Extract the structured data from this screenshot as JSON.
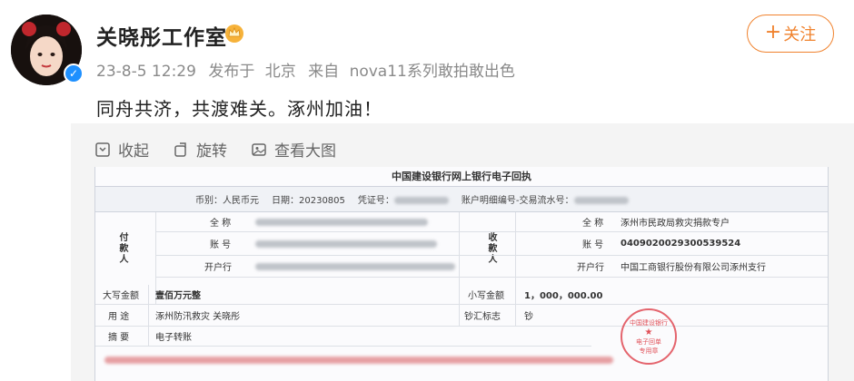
{
  "user": {
    "name": "关晓彤工作室",
    "verified_mark": "✓"
  },
  "meta": {
    "date_time": "23-8-5 12:29",
    "published_prefix": "发布于",
    "location": "北京",
    "source_prefix": "来自",
    "device": "nova11系列敢拍敢出色"
  },
  "follow": {
    "plus": "+",
    "label": "关注"
  },
  "post": {
    "text": "同舟共济，共渡难关。涿州加油！"
  },
  "toolbar": {
    "collapse": "收起",
    "rotate": "旋转",
    "view_large": "查看大图"
  },
  "receipt": {
    "title": "中国建设银行网上银行电子回执",
    "currency_label": "币别：",
    "currency": "人民币元",
    "date_label": "日期：",
    "date": "20230805",
    "voucher_label": "凭证号：",
    "serial_label": "账户明细编号-交易流水号：",
    "payer_label": "付款人",
    "payee_label": "收款人",
    "full_name_label": "全 称",
    "account_label": "账 号",
    "bank_label": "开户行",
    "payee_name": "涿州市民政局救灾捐款专户",
    "payee_account": "0409020029300539524",
    "payee_bank": "中国工商银行股份有限公司涿州支行",
    "amount_upper_label": "大写金额",
    "amount_upper": "壹佰万元整",
    "amount_lower_label": "小写金额",
    "amount_lower": "1，000，000.00",
    "purpose_label": "用 途",
    "purpose": "涿州防汛救灾 关晓彤",
    "cash_flag_label": "钞汇标志",
    "cash_flag": "钞",
    "summary_label": "摘 要",
    "summary": "电子转账",
    "stamp_top": "中国建设银行",
    "stamp_mid": "电子回单",
    "stamp_bottom": "专用章"
  },
  "colors": {
    "accent": "#f0822d",
    "verified": "#1e90ff",
    "meta_gray": "#8a8a8a"
  },
  "icons": [
    "crown-icon",
    "verified-icon",
    "collapse-icon",
    "rotate-icon",
    "view-large-icon"
  ]
}
